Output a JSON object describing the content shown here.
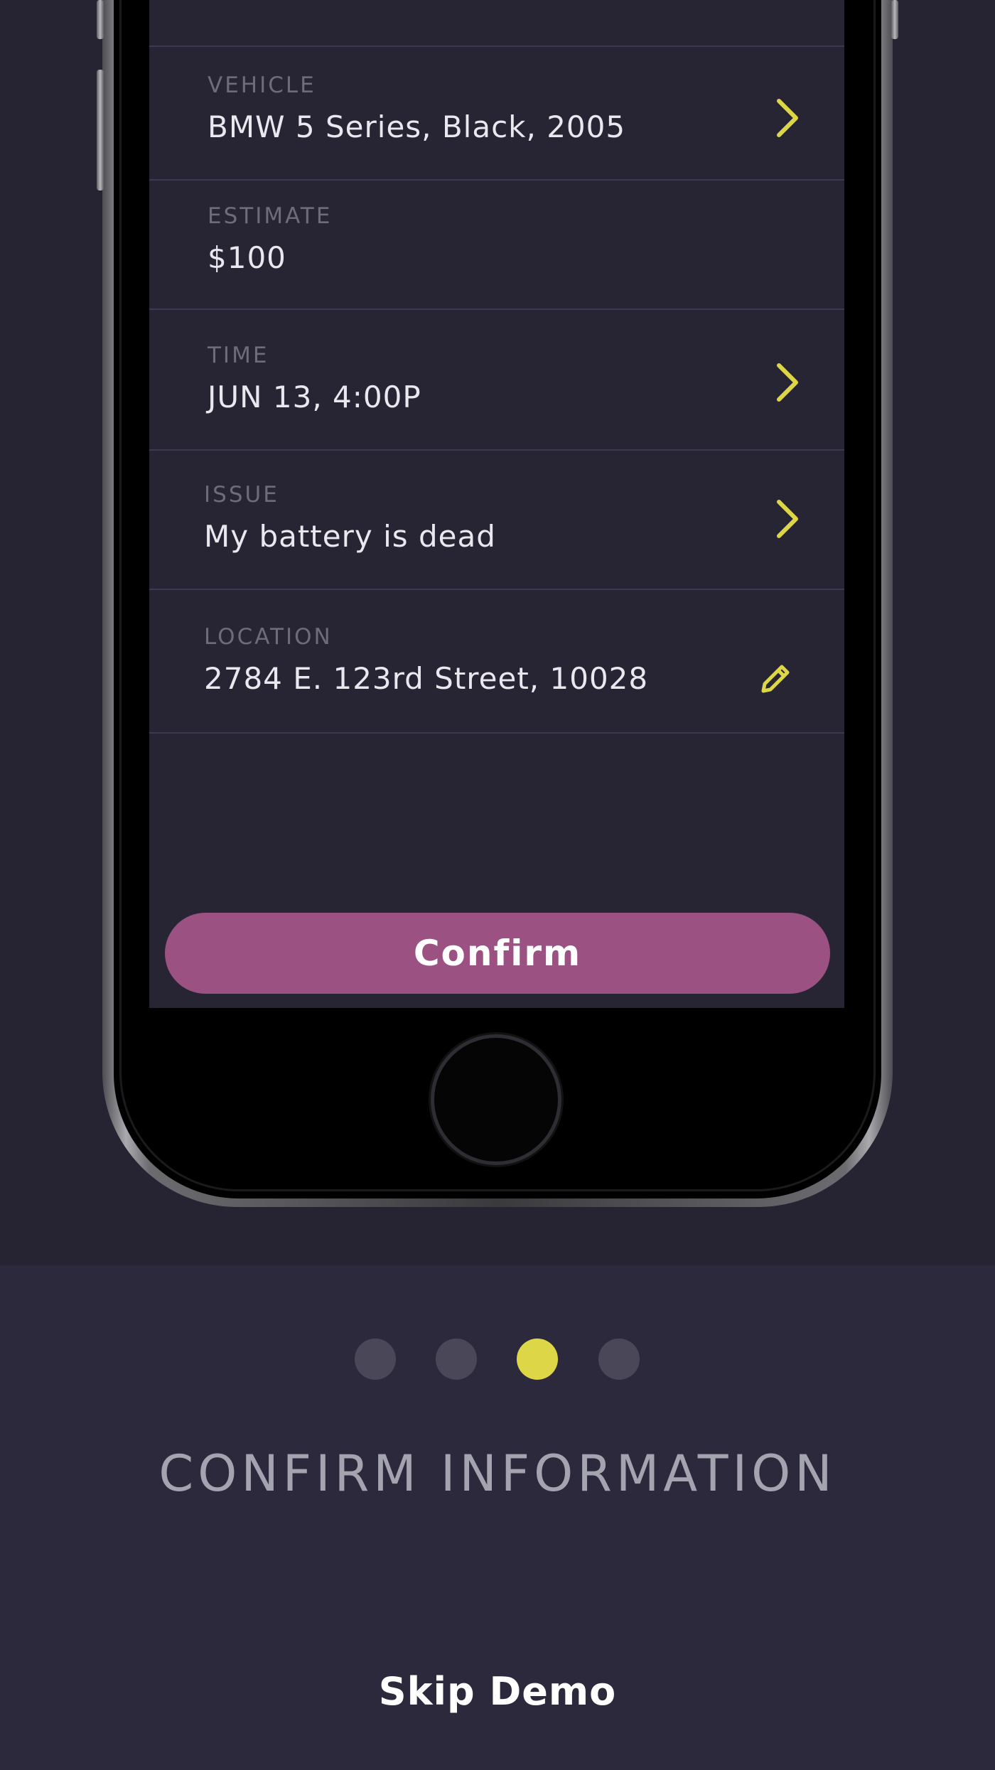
{
  "rows": [
    {
      "label": "VEHICLE",
      "value": "BMW 5 Series, Black, 2005",
      "action_icon": "chevron-right-icon"
    },
    {
      "label": "ESTIMATE",
      "value": "$100",
      "action_icon": ""
    },
    {
      "label": "TIME",
      "value": "JUN 13, 4:00P",
      "action_icon": "chevron-right-icon"
    },
    {
      "label": "ISSUE",
      "value": "My battery is dead",
      "action_icon": "chevron-right-icon"
    },
    {
      "label": "LOCATION",
      "value": "2784 E. 123rd Street, 10028",
      "action_icon": "pencil-icon"
    }
  ],
  "confirm_button": {
    "label": "Confirm"
  },
  "pagination": {
    "total": 4,
    "active_index": 2
  },
  "page_title": "CONFIRM INFORMATION",
  "skip_button": {
    "label": "Skip Demo"
  },
  "colors": {
    "background_top": "#262433",
    "background_bottom": "#2d293c",
    "screen": "#272534",
    "accent_yellow": "#ddd646",
    "confirm_button": "#9b5283",
    "dot_inactive": "#4a4858",
    "dot_active": "#ddd646"
  }
}
